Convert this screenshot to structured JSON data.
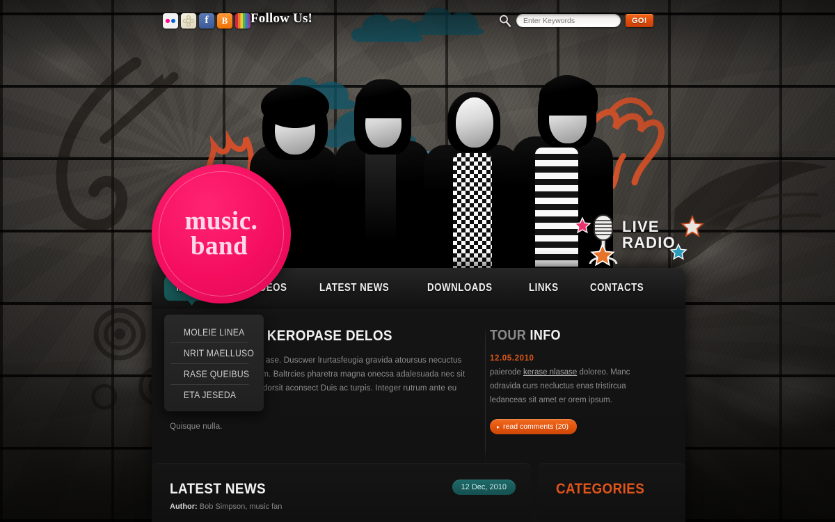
{
  "topbar": {
    "social_icons": [
      {
        "name": "flickr-icon",
        "label": "Flickr"
      },
      {
        "name": "delicious-icon",
        "label": "Delicious"
      },
      {
        "name": "facebook-icon",
        "label": "f"
      },
      {
        "name": "blogger-icon",
        "label": "B"
      },
      {
        "name": "rainbow-icon",
        "label": "Feed"
      }
    ],
    "follow_us": "Follow Us!",
    "search": {
      "placeholder": "Enter Keywords",
      "value": "",
      "go_label": "GO!"
    }
  },
  "logo": {
    "line1": "music.",
    "line2": "band"
  },
  "live_radio": {
    "line1": "LIVE",
    "line2": "RADIO"
  },
  "nav": {
    "items": [
      {
        "label": "MUSIC",
        "active": true
      },
      {
        "label": "VIDEOS",
        "active": false
      },
      {
        "label": "LATEST NEWS",
        "active": false
      },
      {
        "label": "DOWNLOADS",
        "active": false
      },
      {
        "label": "LINKS",
        "active": false
      },
      {
        "label": "CONTACTS",
        "active": false
      }
    ],
    "dropdown": [
      {
        "label": "MOLEIE LINEA"
      },
      {
        "label": "NRIT MAELLUSO"
      },
      {
        "label": "RASE QUEIBUS"
      },
      {
        "label": "ETA JESEDA"
      }
    ]
  },
  "main": {
    "heading": "URAS NIASER KEROPASE DELOS",
    "paragraph1": "ase queibus etajesedaser ase. Duscwer lrurtasfeugia gravida atoursus necuctus oreecenas tristiqu orci aem. Baltrcies pharetra magna onecsa adalesuada nec sit ameumertase dertasfase dorsit aconsect Duis ac turpis. Integer rutrum ante eu lacus.",
    "paragraph2": "Quisque nulla."
  },
  "tour": {
    "title_part1": "TOUR ",
    "title_part2": "INFO",
    "date": "12.05.2010",
    "text_before": "paierode ",
    "link": "kerase nlasase",
    "text_after": " doloreo. Manc odravida curs necluctus enas tristircua ledanceas sit amet er orem ipsum.",
    "button": "read comments (20)",
    "button_arrow": "▸"
  },
  "news": {
    "title": "LATEST NEWS",
    "author_label": "Author:",
    "author_value": "Bob Simpson, music fan",
    "date_badge": "12 Dec, 2010"
  },
  "categories": {
    "title": "CATEGORIES"
  },
  "colors": {
    "pink": "#f50e5f",
    "orange": "#e0541a",
    "teal": "#1d6a6a",
    "panel": "#141414"
  }
}
